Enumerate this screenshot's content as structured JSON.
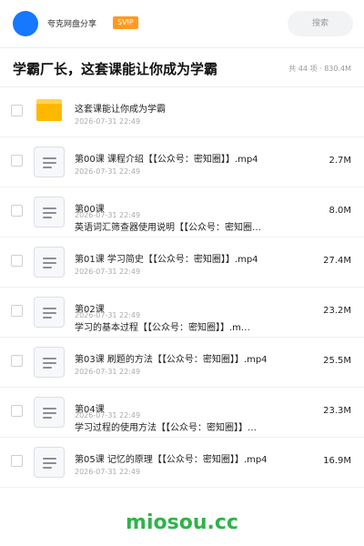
{
  "header": {
    "app_name": "夸克网盘分享",
    "badge": "SVIP",
    "search_placeholder": "搜索",
    "avatar_color": "#1677ff"
  },
  "title_bar": {
    "title": "学霸厂长，这套课能让你成为学霸",
    "summary": "共 44 项 · 830.4M"
  },
  "files": [
    {
      "type": "folder",
      "name": "这套课能让你成为学霸",
      "date": "2026-07-31 22:49",
      "size": ""
    },
    {
      "type": "file",
      "name": "第00课 课程介绍【【公众号：密知圈】】.mp4",
      "date": "2026-07-31 22:49",
      "size": "2.7M"
    },
    {
      "type": "file",
      "name_line1": "第00课",
      "name_line2": "英语词汇筛查器使用说明【【公众号：密知圈…",
      "date": "2026-07-31 22:49",
      "size": "8.0M"
    },
    {
      "type": "file",
      "name": "第01课 学习简史【【公众号：密知圈】】.mp4",
      "date": "2026-07-31 22:49",
      "size": "27.4M"
    },
    {
      "type": "file",
      "name_line1": "第02课",
      "name_line2": "学习的基本过程【【公众号：密知圈】】.m…",
      "date": "2026-07-31 22:49",
      "size": "23.2M"
    },
    {
      "type": "file",
      "name": "第03课 刷题的方法【【公众号：密知圈】】.mp4",
      "date": "2026-07-31 22:49",
      "size": "25.5M"
    },
    {
      "type": "file",
      "name_line1": "第04课",
      "name_line2": "学习过程的使用方法【【公众号：密知圈】】…",
      "date": "2026-07-31 22:49",
      "size": "23.3M"
    },
    {
      "type": "file",
      "name": "第05课 记忆的原理【【公众号：密知圈】】.mp4",
      "date": "2026-07-31 22:49",
      "size": "16.9M"
    }
  ],
  "watermark": "miosou.cc",
  "colors": {
    "accent": "#1677ff",
    "svip": "#ff9a1f",
    "folder": "#ffb800",
    "watermark": "#2fb34a"
  }
}
